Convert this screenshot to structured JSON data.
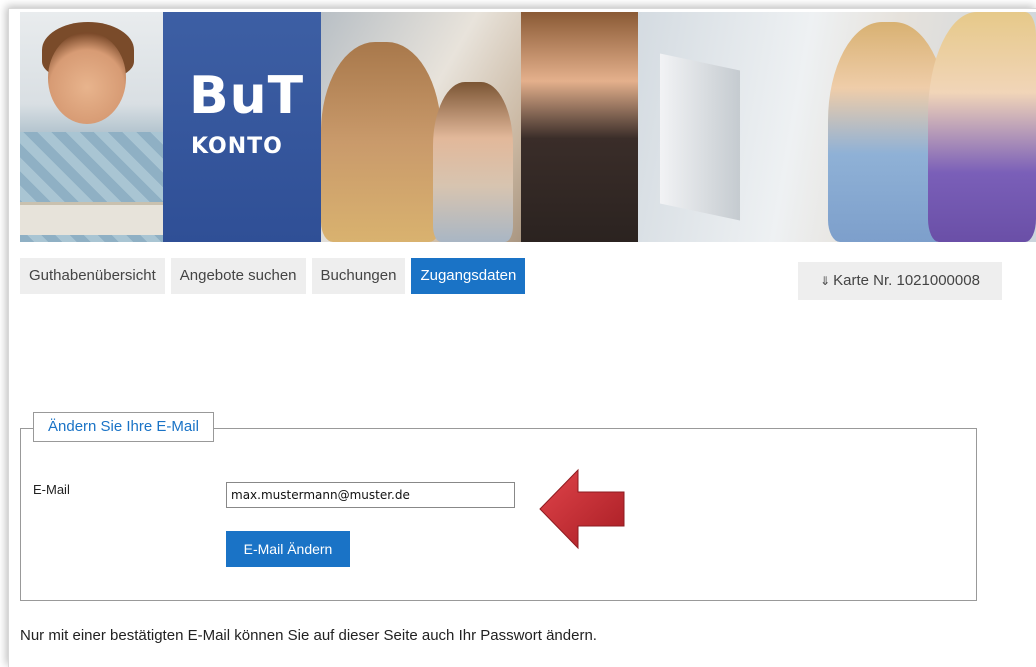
{
  "header": {
    "logo_big": "BuT",
    "logo_small": "KONTO"
  },
  "nav": {
    "tabs": [
      {
        "label": "Guthabenübersicht",
        "active": false
      },
      {
        "label": "Angebote suchen",
        "active": false
      },
      {
        "label": "Buchungen",
        "active": false
      },
      {
        "label": "Zugangsdaten",
        "active": true
      }
    ],
    "card_arrow": "⇓",
    "card_label": "Karte Nr. 1021000008"
  },
  "email_form": {
    "legend": "Ändern Sie Ihre E-Mail",
    "label": "E-Mail",
    "value": "max.mustermann@muster.de",
    "submit_label": "E-Mail Ändern"
  },
  "note": "Nur mit einer bestätigten E-Mail können Sie auf dieser Seite auch Ihr Passwort ändern.",
  "colors": {
    "accent": "#1a73c6",
    "logo_panel": "#3d5fa4",
    "arrow": "#c4262e"
  }
}
